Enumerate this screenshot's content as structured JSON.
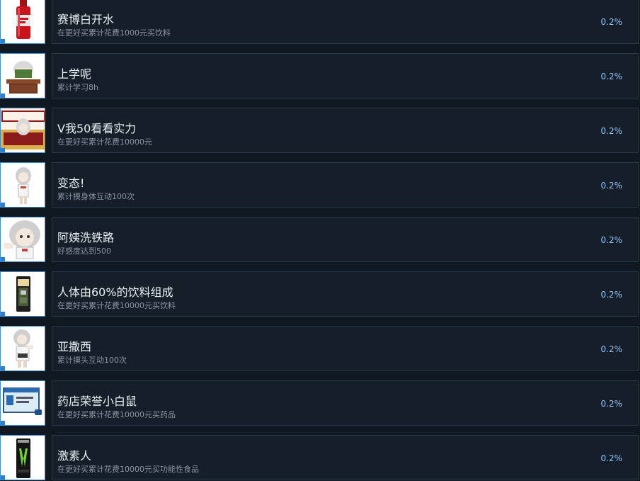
{
  "achievements": [
    {
      "title": "赛博白开水",
      "desc": "在更好买累计花费1000元买饮料",
      "percent": "0.2%",
      "icon": "soda-bottle-icon"
    },
    {
      "title": "上学呢",
      "desc": "累计学习8h",
      "percent": "0.2%",
      "icon": "study-desk-icon"
    },
    {
      "title": "V我50看看实力",
      "desc": "在更好买累计花费10000元",
      "percent": "0.2%",
      "icon": "better-buy-icon"
    },
    {
      "title": "变态!",
      "desc": "累计摸身体互动100次",
      "percent": "0.2%",
      "icon": "anime-girl-icon"
    },
    {
      "title": "阿姨洗铁路",
      "desc": "好感度达到500",
      "percent": "0.2%",
      "icon": "anime-girl-face-icon"
    },
    {
      "title": "人体由60%的饮料组成",
      "desc": "在更好买累计花费10000元买饮料",
      "percent": "0.2%",
      "icon": "drink-can-icon"
    },
    {
      "title": "亚撒西",
      "desc": "累计摸头互动100次",
      "percent": "0.2%",
      "icon": "anime-girl-icon"
    },
    {
      "title": "药店荣誉小白鼠",
      "desc": "在更好买累计花费10000元买药品",
      "percent": "0.2%",
      "icon": "pharmacy-card-icon"
    },
    {
      "title": "激素人",
      "desc": "在更好买累计花费10000元买功能性食品",
      "percent": "0.2%",
      "icon": "energy-drink-icon"
    }
  ]
}
